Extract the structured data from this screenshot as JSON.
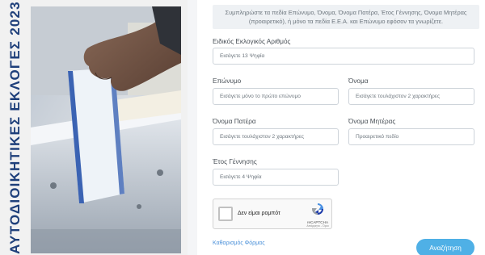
{
  "left": {
    "vertical_title": "ΑΥΤΟΔΙΟΙΚΗΤΙΚΕΣ ΕΚΛΟΓΕΣ 2023"
  },
  "form": {
    "intro": "Συμπληρώστε τα πεδία Επώνυμο, Όνομα, Όνομα Πατέρα, Έτος Γέννησης, Όνομα Μητέρας (προαιρετικό), ή μόνο τα πεδία Ε.Ε.Α. και Επώνυμο εφόσον τα γνωρίζετε.",
    "eea_label": "Ειδικός Εκλογικός Αριθμός",
    "eea_placeholder": "Εισάγετε 13 Ψηφία",
    "surname_label": "Επώνυμο",
    "surname_placeholder": "Εισάγετε μόνο το πρώτο επώνυμο",
    "name_label": "Όνομα",
    "name_placeholder": "Εισάγετε τουλάχιστον 2 χαρακτήρες",
    "father_label": "Όνομα Πατέρα",
    "father_placeholder": "Εισάγετε τουλάχιστον 2 χαρακτήρες",
    "mother_label": "Όνομα Μητέρας",
    "mother_placeholder": "Προαιρετικό πεδίο",
    "year_label": "Έτος Γέννησης",
    "year_placeholder": "Εισάγετε 4 Ψηφία",
    "captcha_text": "Δεν είμαι ρομπότ",
    "captcha_brand": "reCAPTCHA",
    "captcha_terms": "Απόρρητο - Όροι",
    "reset_label": "Καθαρισμός Φόρμας",
    "submit_label": "Αναζήτηση"
  },
  "colors": {
    "title_blue": "#1e3f7a",
    "submit_blue": "#4fb0e6",
    "link_blue": "#4a90d9"
  }
}
